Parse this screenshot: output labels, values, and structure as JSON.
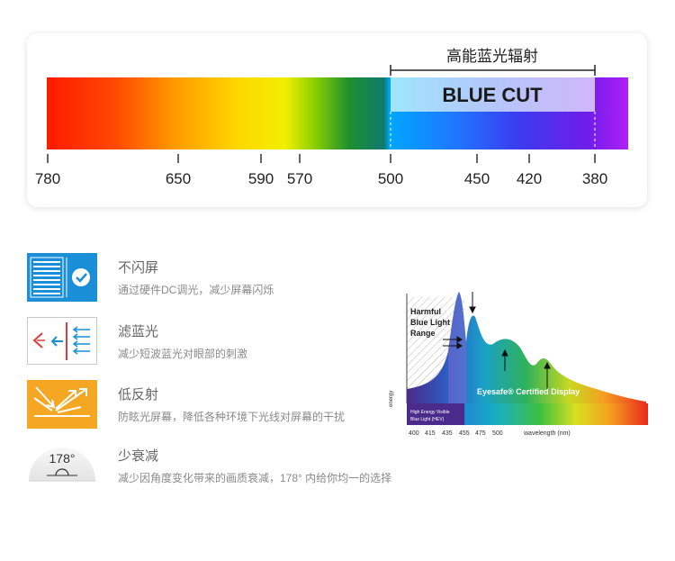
{
  "spectrum": {
    "bracket_label": "高能蓝光辐射",
    "blue_cut_label": "BLUE CUT",
    "ticks": [
      "780",
      "650",
      "590",
      "570",
      "500",
      "450",
      "420",
      "380"
    ]
  },
  "features": [
    {
      "title": "不闪屏",
      "desc": "通过硬件DC调光，减少屏幕闪烁",
      "icon": "dc-dimming-icon"
    },
    {
      "title": "滤蓝光",
      "desc": "减少短波蓝光对眼部的刺激",
      "icon": "blue-light-filter-icon"
    },
    {
      "title": "低反射",
      "desc": "防眩光屏幕，降低各种环境下光线对屏幕的干扰",
      "icon": "low-reflection-icon"
    },
    {
      "title": "少衰减",
      "desc": "减少因角度变化带来的画质衰减，178° 内给你均一的选择",
      "icon": "viewing-angle-icon",
      "icon_text": "178°"
    }
  ],
  "eyesafe_chart": {
    "harmful_label_1": "Harmful",
    "harmful_label_2": "Blue Light",
    "harmful_label_3": "Range",
    "certified_label": "Eyesafe® Certified Display",
    "y_axis_label": "energy",
    "hev_label_1": "High Energy Visible",
    "hev_label_2": "Blue Light (HEV)",
    "x_ticks": [
      "400",
      "415",
      "435",
      "455",
      "475",
      "500"
    ],
    "x_axis_label": "wavelength (nm)"
  },
  "colors": {
    "accent_blue": "#1a8fd8",
    "accent_orange": "#f5a623",
    "hev_purple": "#4a2a8a"
  }
}
